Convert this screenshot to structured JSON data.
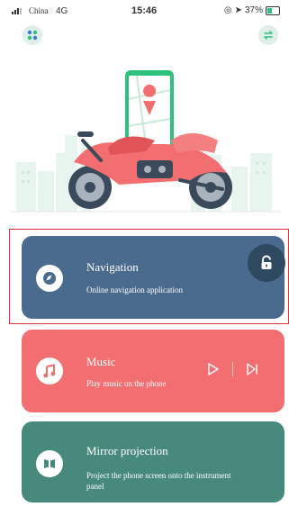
{
  "status_bar": {
    "carrier": "China",
    "network": "4G",
    "time": "15:46",
    "battery": "37%"
  },
  "icons": {
    "menu": "grid-menu-icon",
    "switch": "switch-icon",
    "lock": "lock-icon",
    "navigation": "navigation-compass-icon",
    "music": "music-note-icon",
    "mirror": "mirror-projection-icon",
    "play": "play-icon",
    "next": "skip-next-icon"
  },
  "colors": {
    "navigation_card": "#4b6b8e",
    "music_card": "#f26e70",
    "mirror_card": "#48897e",
    "highlight": "#d8323a",
    "accent": "#2ec27e"
  },
  "cards": {
    "navigation": {
      "title": "Navigation",
      "subtitle": "Online navigation application"
    },
    "music": {
      "title": "Music",
      "subtitle": "Play music on the phone"
    },
    "mirror": {
      "title": "Mirror projection",
      "subtitle": "Project the phone screen onto the instrument panel"
    }
  }
}
